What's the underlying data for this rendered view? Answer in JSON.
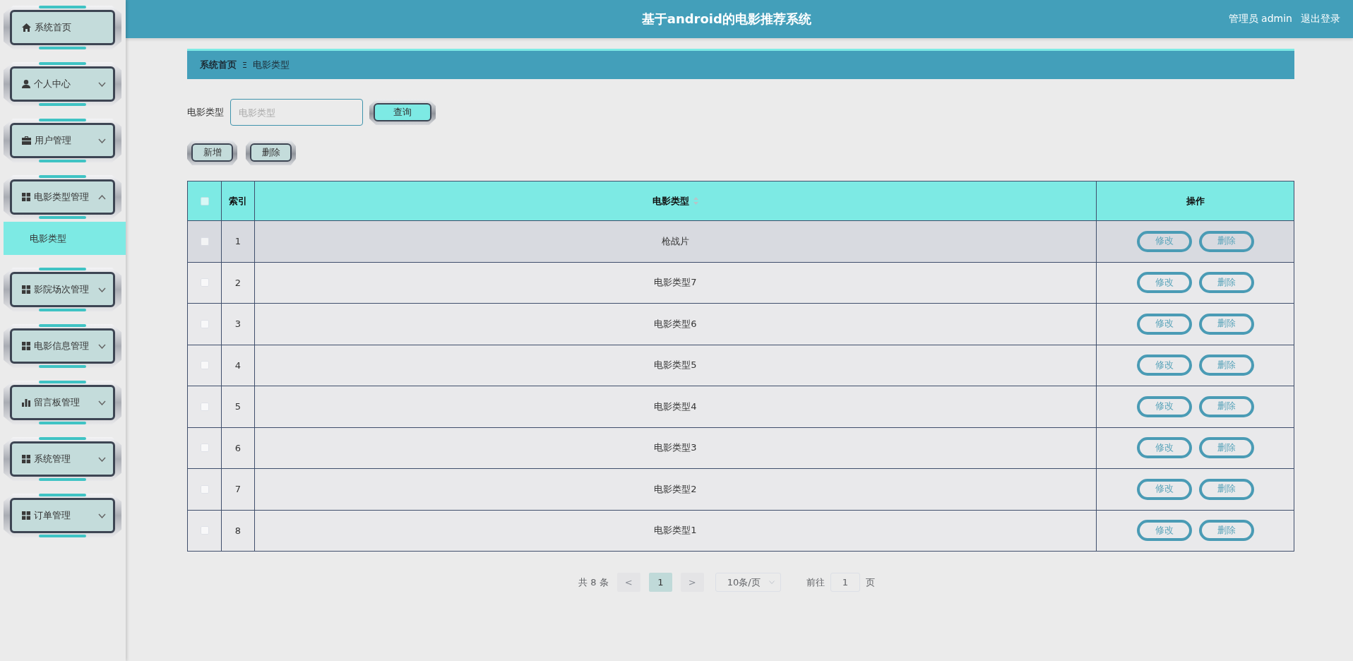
{
  "header": {
    "title": "基于android的电影推荐系统",
    "user": "管理员 admin",
    "logout": "退出登录"
  },
  "sidebar": {
    "items": [
      {
        "label": "系统首页"
      },
      {
        "label": "个人中心",
        "expanded": false
      },
      {
        "label": "用户管理",
        "expanded": false
      },
      {
        "label": "电影类型管理",
        "expanded": true,
        "children": [
          {
            "label": "电影类型",
            "selected": true
          }
        ]
      },
      {
        "label": "影院场次管理",
        "expanded": false
      },
      {
        "label": "电影信息管理",
        "expanded": false
      },
      {
        "label": "留言板管理",
        "expanded": false
      },
      {
        "label": "系统管理",
        "expanded": false
      },
      {
        "label": "订单管理",
        "expanded": false
      }
    ]
  },
  "breadcrumb": {
    "items": [
      "系统首页",
      "电影类型"
    ],
    "separator": "Ξ"
  },
  "search": {
    "label": "电影类型",
    "placeholder": "电影类型",
    "button": "查询"
  },
  "actions": [
    "新增",
    "删除"
  ],
  "table": {
    "columns": [
      "索引",
      "电影类型",
      "操作"
    ],
    "header_checked": false,
    "rows": [
      {
        "index": "1",
        "type": "枪战片",
        "checked": false,
        "hovered": true,
        "actions": [
          "修改",
          "删除"
        ]
      },
      {
        "index": "2",
        "type": "电影类型7",
        "checked": false,
        "hovered": false,
        "actions": [
          "修改",
          "删除"
        ]
      },
      {
        "index": "3",
        "type": "电影类型6",
        "checked": false,
        "hovered": false,
        "actions": [
          "修改",
          "删除"
        ]
      },
      {
        "index": "4",
        "type": "电影类型5",
        "checked": false,
        "hovered": false,
        "actions": [
          "修改",
          "删除"
        ]
      },
      {
        "index": "5",
        "type": "电影类型4",
        "checked": false,
        "hovered": false,
        "actions": [
          "修改",
          "删除"
        ]
      },
      {
        "index": "6",
        "type": "电影类型3",
        "checked": false,
        "hovered": false,
        "actions": [
          "修改",
          "删除"
        ]
      },
      {
        "index": "7",
        "type": "电影类型2",
        "checked": false,
        "hovered": false,
        "actions": [
          "修改",
          "删除"
        ]
      },
      {
        "index": "8",
        "type": "电影类型1",
        "checked": false,
        "hovered": false,
        "actions": [
          "修改",
          "删除"
        ]
      }
    ]
  },
  "pagination": {
    "total": "共 8 条",
    "prev": "<",
    "pages": [
      {
        "label": "1",
        "selected": true
      }
    ],
    "next": ">",
    "page_size": "10条/页",
    "goto_label": "前往",
    "goto_value": "1",
    "goto_suffix": "页"
  }
}
